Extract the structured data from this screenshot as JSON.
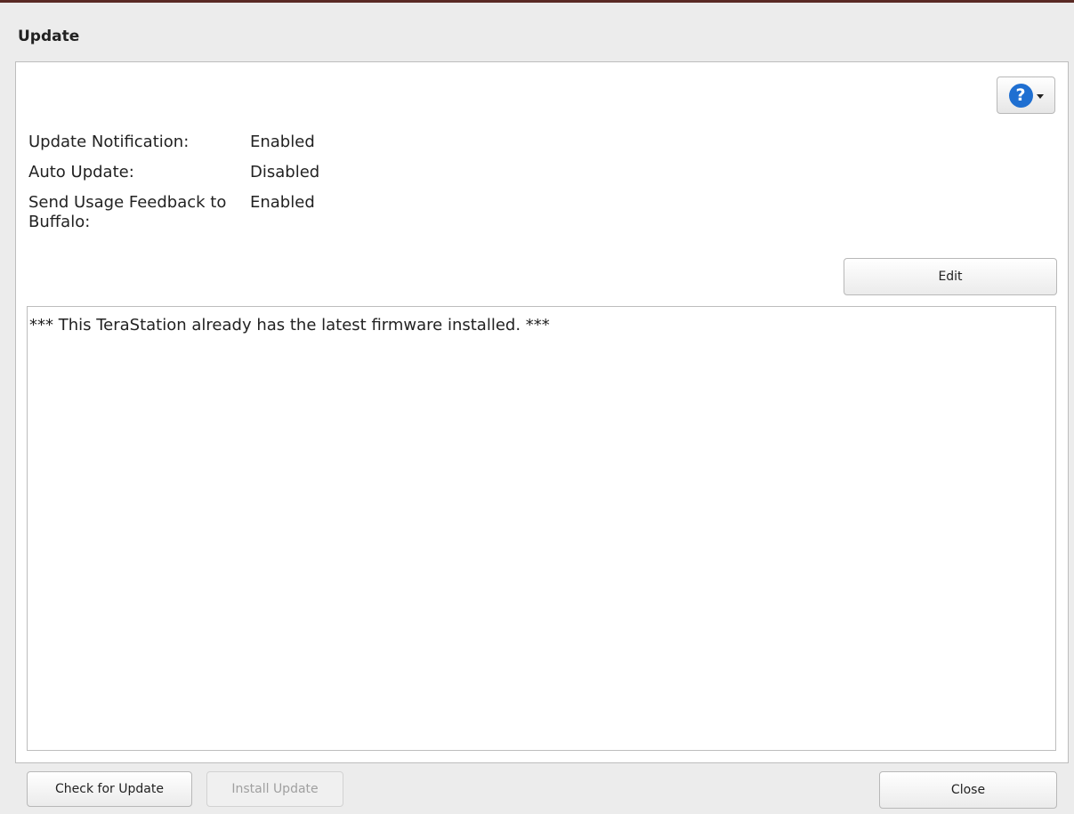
{
  "dialog": {
    "title": "Update"
  },
  "help": {
    "icon": "help-icon",
    "glyph": "?",
    "accent": "#1f6fd1"
  },
  "settings": [
    {
      "label": "Update Notification:",
      "value": "Enabled"
    },
    {
      "label": "Auto Update:",
      "value": "Disabled"
    },
    {
      "label": "Send Usage Feedback to Buffalo:",
      "value": "Enabled"
    }
  ],
  "edit_button": {
    "label": "Edit"
  },
  "message": {
    "text": "*** This TeraStation already has the latest firmware installed. ***"
  },
  "footer": {
    "check_label": "Check for Update",
    "install_label": "Install Update",
    "install_enabled": false,
    "close_label": "Close"
  }
}
